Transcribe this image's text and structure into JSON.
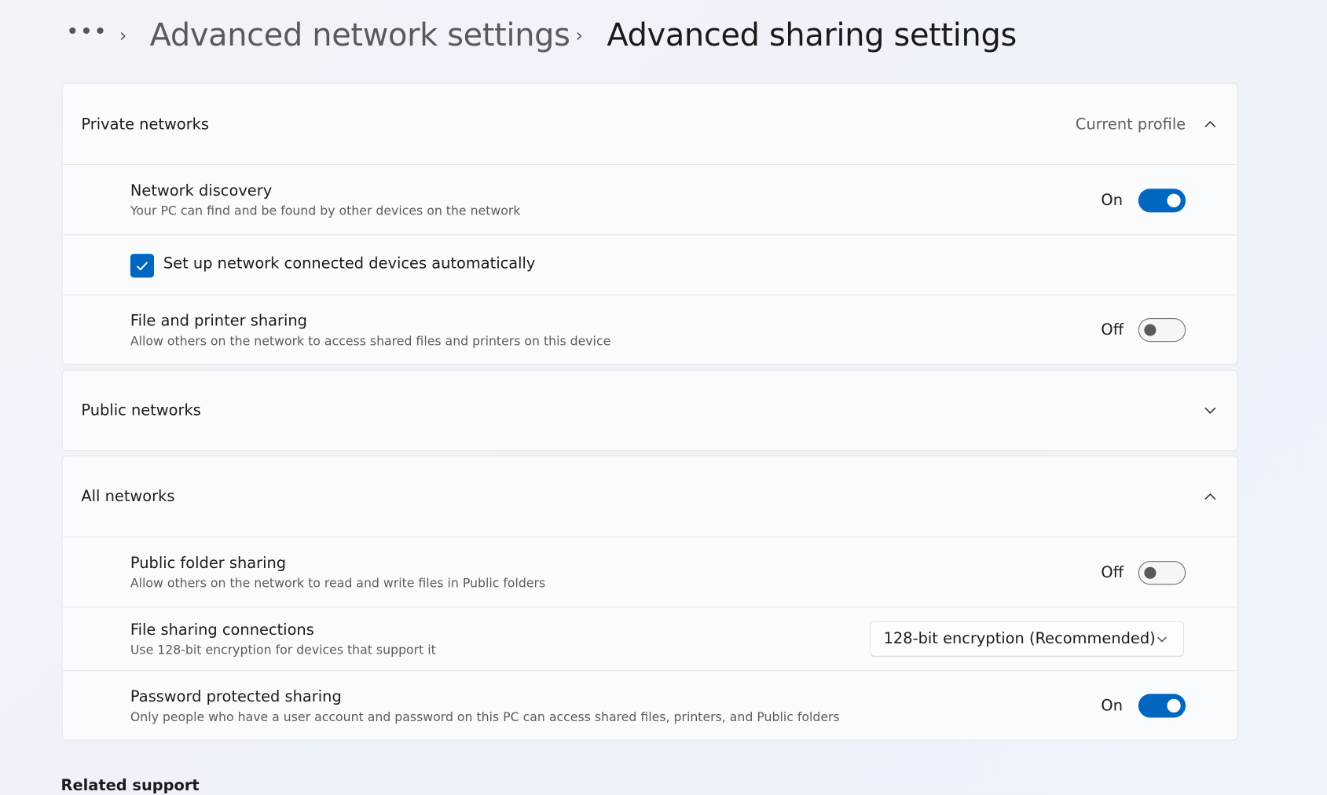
{
  "breadcrumb": {
    "more": "•••",
    "items": [
      "Advanced network settings",
      "Advanced sharing settings"
    ]
  },
  "sections": {
    "private": {
      "title": "Private networks",
      "badge": "Current profile",
      "expanded": true,
      "network_discovery": {
        "title": "Network discovery",
        "subtitle": "Your PC can find and be found by other devices on the network",
        "state": "On",
        "on": true
      },
      "auto_setup": {
        "label": "Set up network connected devices automatically",
        "checked": true
      },
      "file_printer": {
        "title": "File and printer sharing",
        "subtitle": "Allow others on the network to access shared files and printers on this device",
        "state": "Off",
        "on": false
      }
    },
    "public": {
      "title": "Public networks",
      "expanded": false
    },
    "all": {
      "title": "All networks",
      "expanded": true,
      "public_folder": {
        "title": "Public folder sharing",
        "subtitle": "Allow others on the network to read and write files in Public folders",
        "state": "Off",
        "on": false
      },
      "file_conn": {
        "title": "File sharing connections",
        "subtitle": "Use 128-bit encryption for devices that support it",
        "selected": "128-bit encryption (Recommended)"
      },
      "password": {
        "title": "Password protected sharing",
        "subtitle": "Only people who have a user account and password on this PC can access shared files, printers, and Public folders",
        "state": "On",
        "on": true
      }
    }
  },
  "related_support": "Related support",
  "colors": {
    "accent": "#0067c0",
    "background": "#eef2f8",
    "card": "#fafbfd"
  }
}
